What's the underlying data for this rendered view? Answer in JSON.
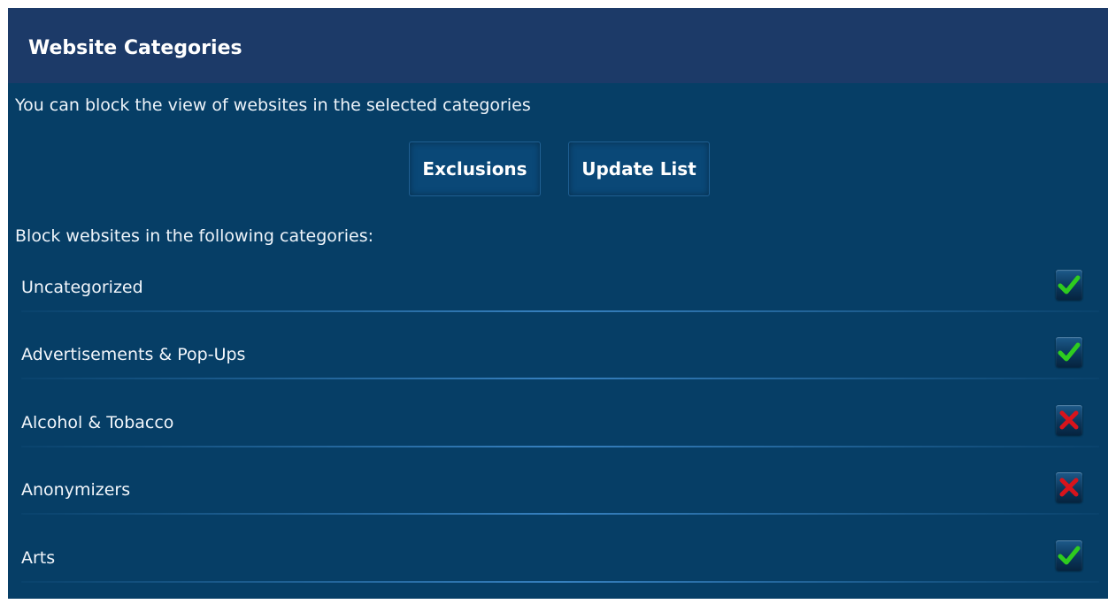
{
  "header": {
    "title": "Website Categories"
  },
  "description": "You can block the view of websites in the selected categories",
  "buttons": {
    "exclusions": "Exclusions",
    "update_list": "Update List"
  },
  "section_label": "Block websites in the following categories:",
  "categories": [
    {
      "label": "Uncategorized",
      "blocked": true,
      "icon": "check-icon"
    },
    {
      "label": "Advertisements & Pop-Ups",
      "blocked": true,
      "icon": "check-icon"
    },
    {
      "label": "Alcohol & Tobacco",
      "blocked": false,
      "icon": "cross-icon"
    },
    {
      "label": "Anonymizers",
      "blocked": false,
      "icon": "cross-icon"
    },
    {
      "label": "Arts",
      "blocked": true,
      "icon": "check-icon"
    }
  ],
  "colors": {
    "panel_background": "#063e66",
    "header_background": "#1c3a68",
    "check_green": "#2ecc1f",
    "cross_red": "#d8141c"
  }
}
